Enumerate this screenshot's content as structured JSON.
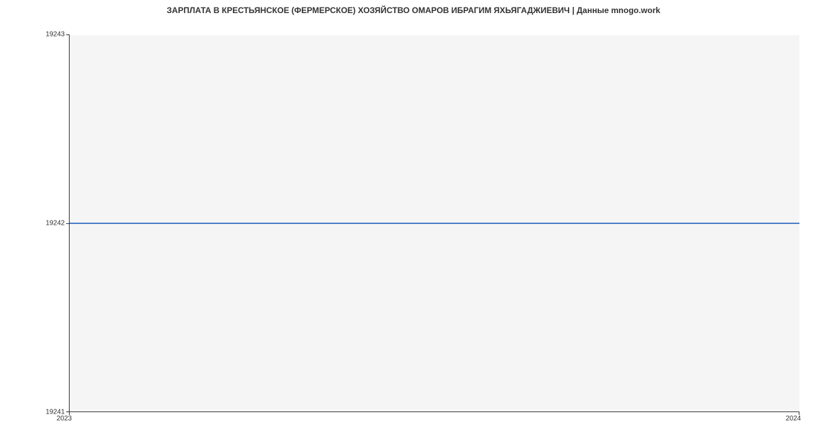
{
  "chart_data": {
    "type": "line",
    "title": "ЗАРПЛАТА В КРЕСТЬЯНСКОЕ (ФЕРМЕРСКОЕ) ХОЗЯЙСТВО ОМАРОВ ИБРАГИМ ЯХЬЯГАДЖИЕВИЧ | Данные mnogo.work",
    "x": [
      2023,
      2024
    ],
    "values": [
      19242,
      19242
    ],
    "xlabel": "",
    "ylabel": "",
    "ylim": [
      19241,
      19243
    ],
    "xlim": [
      2023,
      2024
    ],
    "y_ticks": [
      19241,
      19242,
      19243
    ],
    "x_ticks": [
      2023,
      2024
    ]
  }
}
